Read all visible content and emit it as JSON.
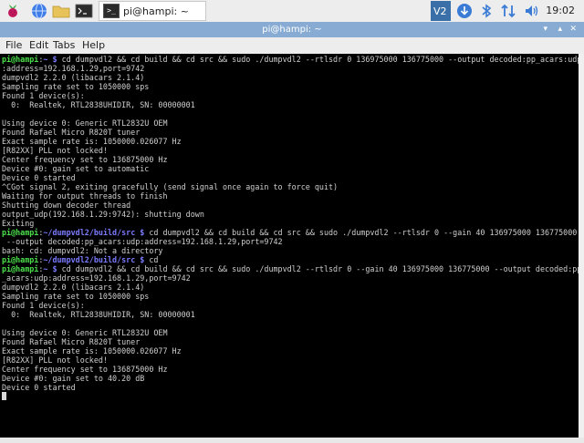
{
  "panel": {
    "task_label": "pi@hampi: ~",
    "task_icon_text": ">_",
    "clock": "19:02",
    "tray_icons": [
      "vnc-icon",
      "download-icon",
      "bluetooth-icon",
      "network-icon",
      "volume-icon"
    ],
    "launcher_icons": [
      "raspberry-menu-icon",
      "web-browser-icon",
      "file-manager-icon",
      "terminal-icon"
    ]
  },
  "window": {
    "title": "pi@hampi: ~",
    "menus": [
      "File",
      "Edit",
      "Tabs",
      "Help"
    ]
  },
  "colors": {
    "prompt_user": "#4be04b",
    "prompt_path": "#7b7bff",
    "terminal_bg": "#000000",
    "terminal_fg": "#cfcfcf",
    "titlebar": "#87abd2"
  },
  "terminal": {
    "lines": [
      [
        {
          "t": "pi@hampi",
          "c": "pg"
        },
        {
          "t": ":"
        },
        {
          "t": "~ $",
          "c": "pb"
        },
        {
          "t": " cd dumpvdl2 && cd build && cd src && sudo ./dumpvdl2 --rtlsdr 0 136975000 136775000 --output decoded:pp_acars:udp"
        }
      ],
      [
        {
          "t": ":address=192.168.1.29,port=9742"
        }
      ],
      [
        {
          "t": "dumpvdl2 2.2.0 (libacars 2.1.4)"
        }
      ],
      [
        {
          "t": "Sampling rate set to 1050000 sps"
        }
      ],
      [
        {
          "t": "Found 1 device(s):"
        }
      ],
      [
        {
          "t": "  0:  Realtek, RTL2838UHIDIR, SN: 00000001"
        }
      ],
      [
        {
          "t": ""
        }
      ],
      [
        {
          "t": "Using device 0: Generic RTL2832U OEM"
        }
      ],
      [
        {
          "t": "Found Rafael Micro R820T tuner"
        }
      ],
      [
        {
          "t": "Exact sample rate is: 1050000.026077 Hz"
        }
      ],
      [
        {
          "t": "[R82XX] PLL not locked!"
        }
      ],
      [
        {
          "t": "Center frequency set to 136875000 Hz"
        }
      ],
      [
        {
          "t": "Device #0: gain set to automatic"
        }
      ],
      [
        {
          "t": "Device 0 started"
        }
      ],
      [
        {
          "t": "^CGot signal 2, exiting gracefully (send signal once again to force quit)"
        }
      ],
      [
        {
          "t": "Waiting for output threads to finish"
        }
      ],
      [
        {
          "t": "Shutting down decoder thread"
        }
      ],
      [
        {
          "t": "output_udp(192.168.1.29:9742): shutting down"
        }
      ],
      [
        {
          "t": "Exiting"
        }
      ],
      [
        {
          "t": "pi@hampi",
          "c": "pg"
        },
        {
          "t": ":"
        },
        {
          "t": "~/dumpvdl2/build/src $",
          "c": "pb"
        },
        {
          "t": " cd dumpvdl2 && cd build && cd src && sudo ./dumpvdl2 --rtlsdr 0 --gain 40 136975000 136775000"
        }
      ],
      [
        {
          "t": " --output decoded:pp_acars:udp:address=192.168.1.29,port=9742"
        }
      ],
      [
        {
          "t": "bash: cd: dumpvdl2: Not a directory"
        }
      ],
      [
        {
          "t": "pi@hampi",
          "c": "pg"
        },
        {
          "t": ":"
        },
        {
          "t": "~/dumpvdl2/build/src $",
          "c": "pb"
        },
        {
          "t": " cd"
        }
      ],
      [
        {
          "t": "pi@hampi",
          "c": "pg"
        },
        {
          "t": ":"
        },
        {
          "t": "~ $",
          "c": "pb"
        },
        {
          "t": " cd dumpvdl2 && cd build && cd src && sudo ./dumpvdl2 --rtlsdr 0 --gain 40 136975000 136775000 --output decoded:pp"
        }
      ],
      [
        {
          "t": "_acars:udp:address=192.168.1.29,port=9742"
        }
      ],
      [
        {
          "t": "dumpvdl2 2.2.0 (libacars 2.1.4)"
        }
      ],
      [
        {
          "t": "Sampling rate set to 1050000 sps"
        }
      ],
      [
        {
          "t": "Found 1 device(s):"
        }
      ],
      [
        {
          "t": "  0:  Realtek, RTL2838UHIDIR, SN: 00000001"
        }
      ],
      [
        {
          "t": ""
        }
      ],
      [
        {
          "t": "Using device 0: Generic RTL2832U OEM"
        }
      ],
      [
        {
          "t": "Found Rafael Micro R820T tuner"
        }
      ],
      [
        {
          "t": "Exact sample rate is: 1050000.026077 Hz"
        }
      ],
      [
        {
          "t": "[R82XX] PLL not locked!"
        }
      ],
      [
        {
          "t": "Center frequency set to 136875000 Hz"
        }
      ],
      [
        {
          "t": "Device #0: gain set to 40.20 dB"
        }
      ],
      [
        {
          "t": "Device 0 started"
        }
      ]
    ]
  }
}
